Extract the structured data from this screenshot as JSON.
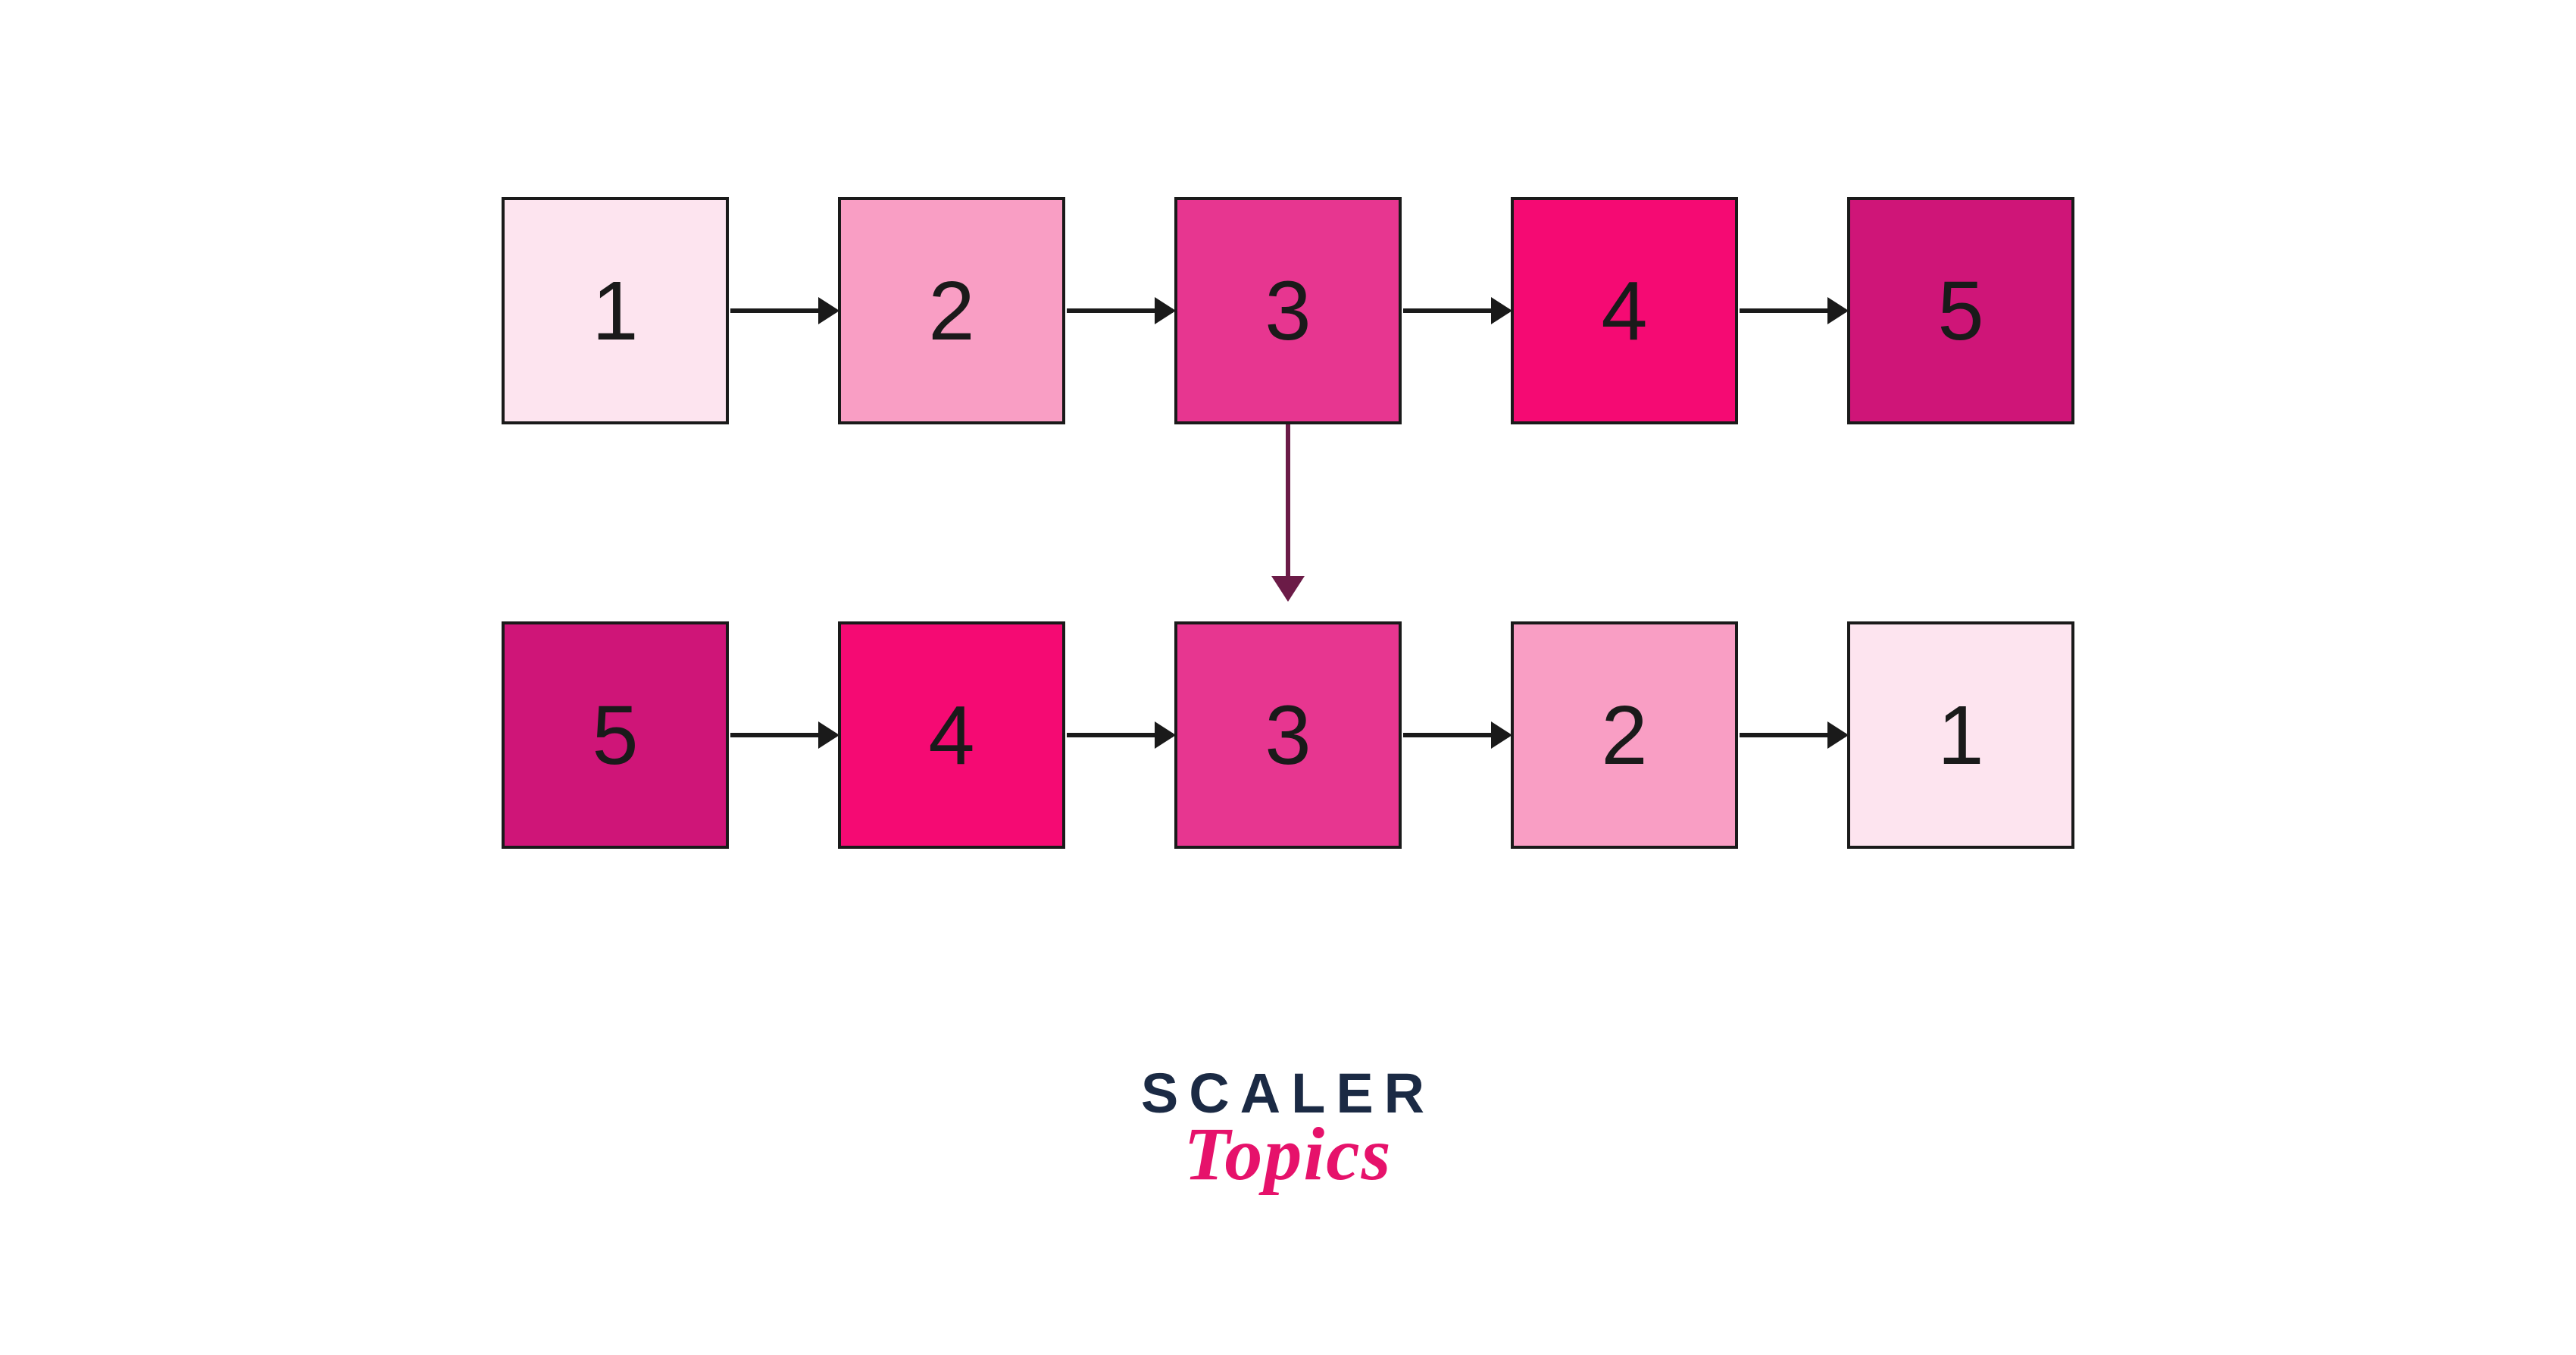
{
  "rows": [
    {
      "nodes": [
        {
          "value": "1",
          "bg": "#fde4ef"
        },
        {
          "value": "2",
          "bg": "#f99ec4"
        },
        {
          "value": "3",
          "bg": "#e73690"
        },
        {
          "value": "4",
          "bg": "#f50a73"
        },
        {
          "value": "5",
          "bg": "#cf1578"
        }
      ]
    },
    {
      "nodes": [
        {
          "value": "5",
          "bg": "#cf1578"
        },
        {
          "value": "4",
          "bg": "#f50a73"
        },
        {
          "value": "3",
          "bg": "#e73690"
        },
        {
          "value": "2",
          "bg": "#f99ec4"
        },
        {
          "value": "1",
          "bg": "#fde4ef"
        }
      ]
    }
  ],
  "logo": {
    "top": "SCALER",
    "bottom": "Topics"
  }
}
